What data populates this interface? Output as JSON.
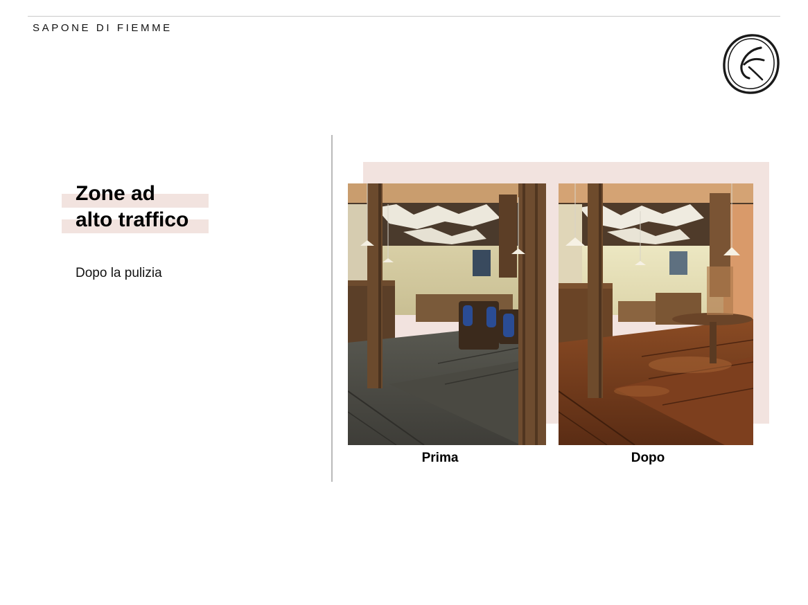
{
  "header": {
    "brand": "SAPONE DI FIEMME"
  },
  "slide": {
    "title_line1": "Zone ad",
    "title_line2": "alto traffico",
    "subtitle": "Dopo la pulizia"
  },
  "photos": {
    "before_caption": "Prima",
    "after_caption": "Dopo"
  },
  "colors": {
    "accent_band": "#f2e3df",
    "wood_dark": "#4a3522",
    "floor_before": "#4c4a42",
    "floor_after": "#6e3a1c"
  },
  "icons": {
    "logo": "circle-swirl-logo-icon"
  }
}
